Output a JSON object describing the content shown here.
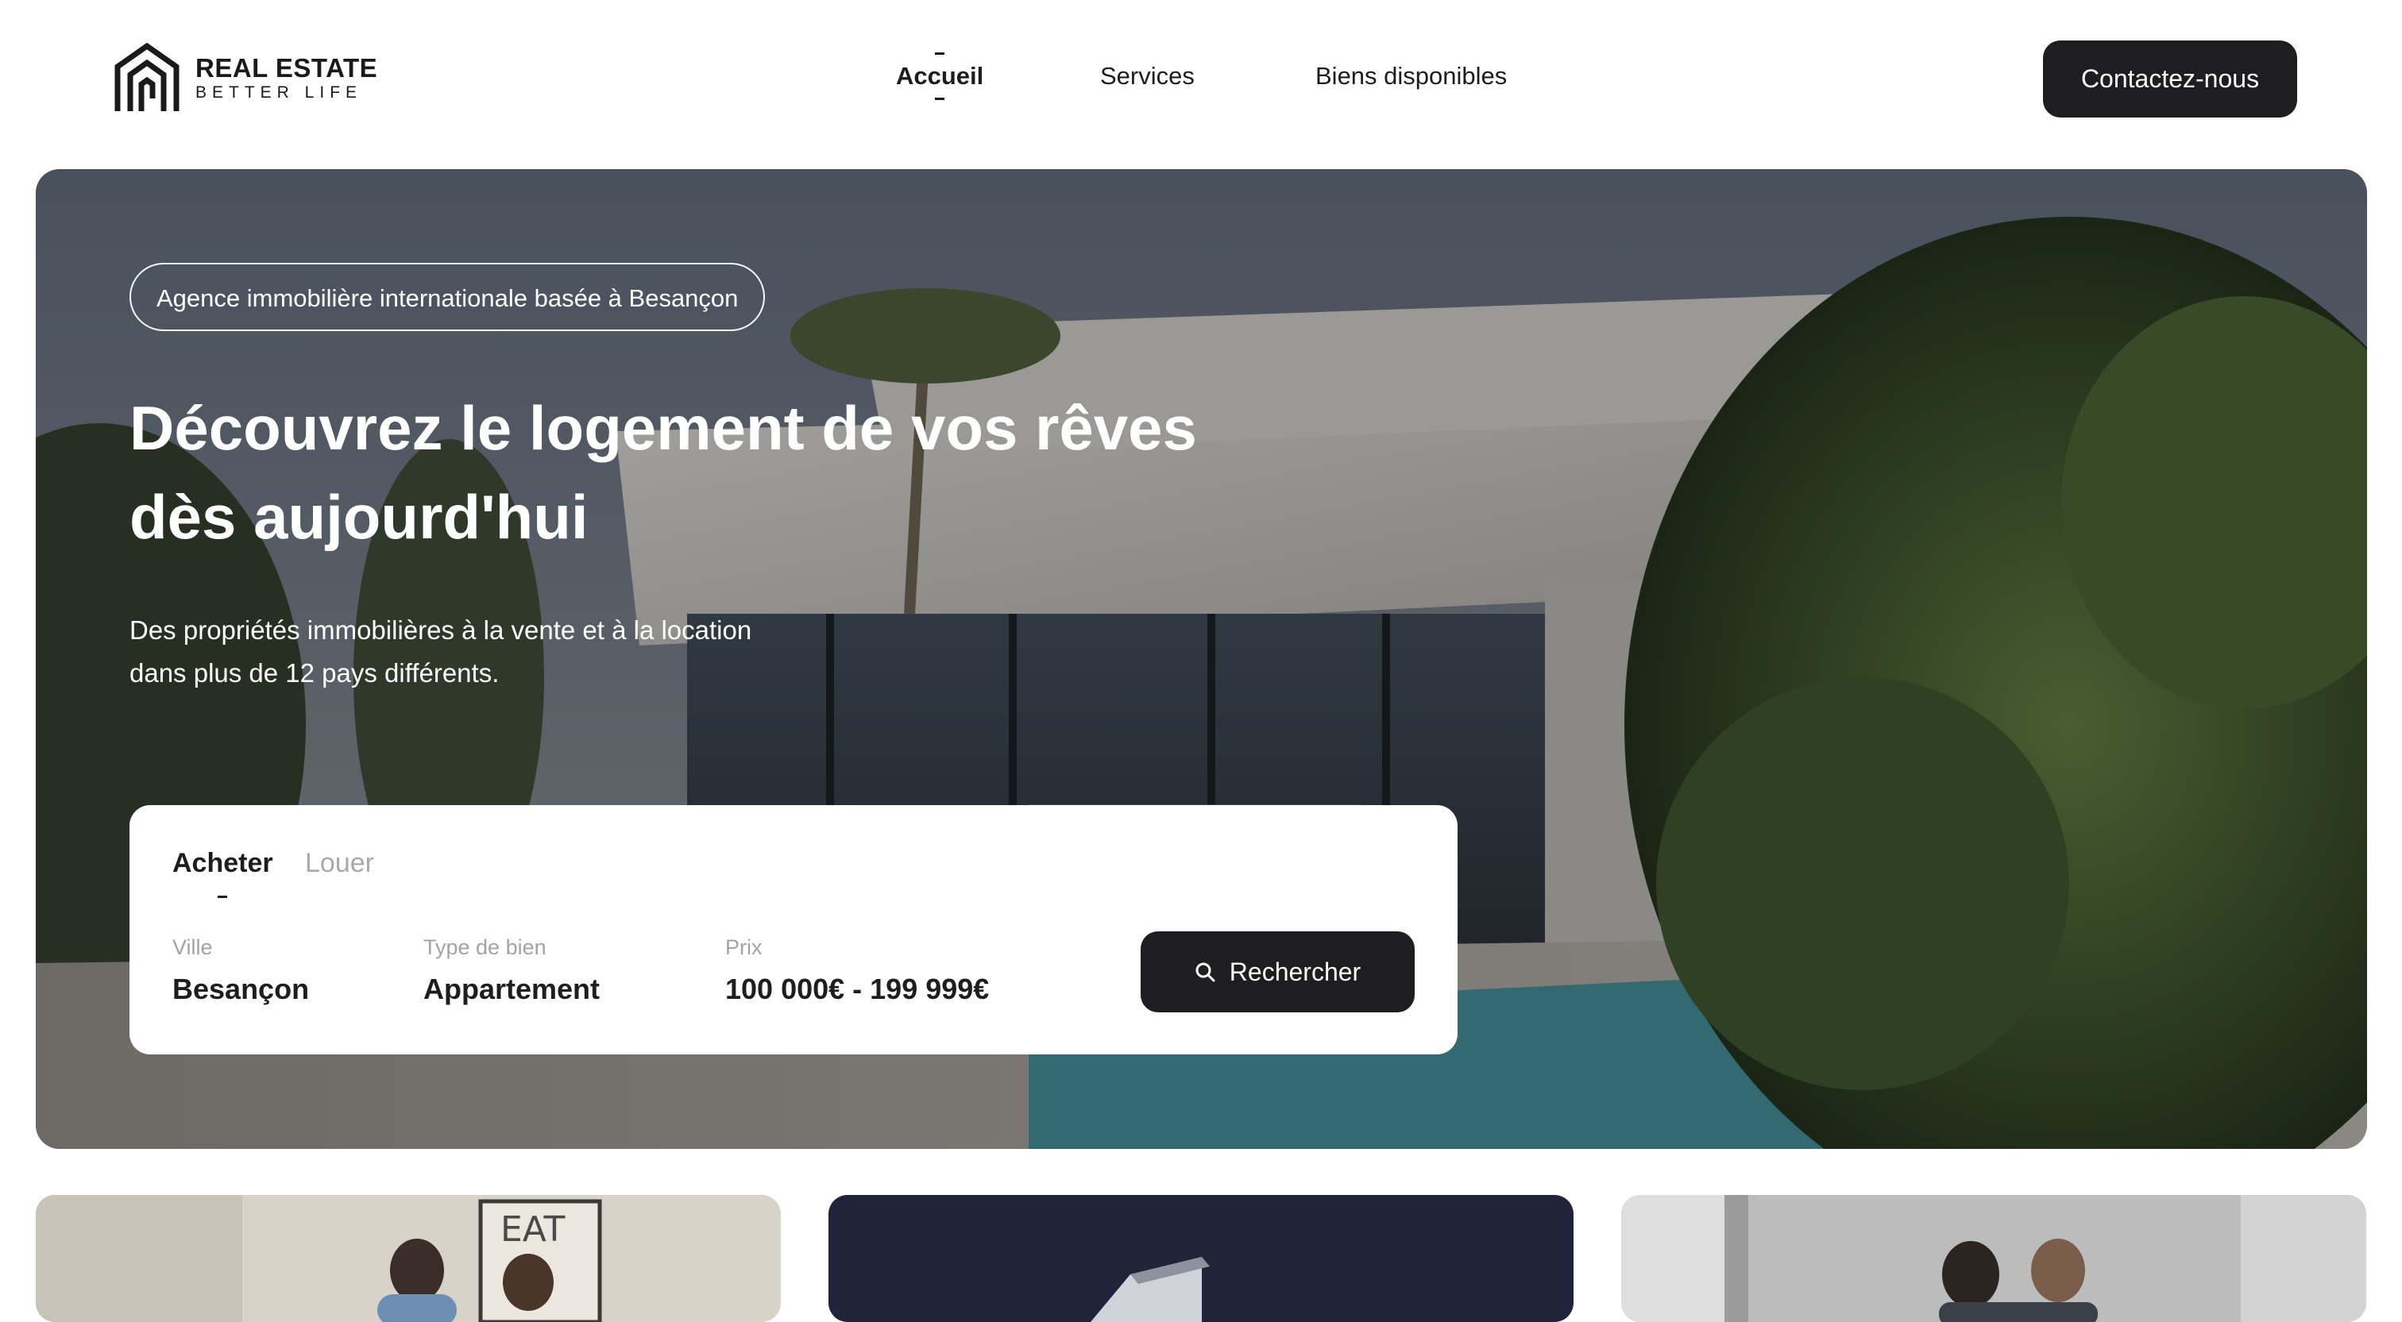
{
  "brand": {
    "title": "REAL ESTATE",
    "subtitle": "BETTER LIFE"
  },
  "nav": {
    "items": [
      {
        "label": "Accueil",
        "active": true
      },
      {
        "label": "Services",
        "active": false
      },
      {
        "label": "Biens disponibles",
        "active": false
      }
    ],
    "contact_label": "Contactez-nous"
  },
  "hero": {
    "badge": "Agence immobilière internationale basée à Besançon",
    "title_line1": "Découvrez le logement de vos rêves",
    "title_line2": "dès aujourd'hui",
    "subtitle_line1": "Des propriétés immobilières à la vente et à la location",
    "subtitle_line2": "dans plus de 12 pays différents."
  },
  "search": {
    "tabs": [
      {
        "label": "Acheter",
        "active": true
      },
      {
        "label": "Louer",
        "active": false
      }
    ],
    "fields": [
      {
        "label": "Ville",
        "value": "Besançon"
      },
      {
        "label": "Type de bien",
        "value": "Appartement"
      },
      {
        "label": "Prix",
        "value": "100 000€ - 199 999€"
      }
    ],
    "button_label": "Rechercher",
    "button_icon": "search-icon"
  },
  "cards": {
    "card1_sign": "EAT"
  },
  "colors": {
    "dark": "#1e1e20",
    "white": "#ffffff",
    "muted": "#a3a3a3"
  }
}
